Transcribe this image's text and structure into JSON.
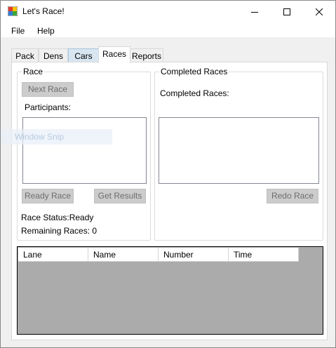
{
  "window": {
    "title": "Let's Race!",
    "minimize_icon": "minimize-icon",
    "maximize_icon": "maximize-icon",
    "close_icon": "close-icon"
  },
  "menu": {
    "items": [
      {
        "label": "File"
      },
      {
        "label": "Help"
      }
    ]
  },
  "tabs": [
    {
      "label": "Pack",
      "state": "normal"
    },
    {
      "label": "Dens",
      "state": "normal"
    },
    {
      "label": "Cars",
      "state": "hover"
    },
    {
      "label": "Races",
      "state": "selected"
    },
    {
      "label": "Reports",
      "state": "normal"
    }
  ],
  "race_group": {
    "legend": "Race",
    "next_race_label": "Next Race",
    "participants_label": "Participants:",
    "ready_race_label": "Ready Race",
    "get_results_label": "Get Results",
    "race_status": "Race Status:Ready",
    "remaining_races": "Remaining Races: 0"
  },
  "completed_group": {
    "legend": "Completed Races",
    "completed_label": "Completed Races:",
    "redo_race_label": "Redo Race"
  },
  "grid": {
    "columns": [
      "Lane",
      "Name",
      "Number",
      "Time"
    ],
    "rows": []
  },
  "overlay": {
    "text": "Window Snip"
  },
  "colors": {
    "disabled_button_bg": "#cccccc",
    "disabled_button_text": "#6d6d6d",
    "grid_background": "#ababab",
    "hover_tab": "#d8e6f2"
  }
}
